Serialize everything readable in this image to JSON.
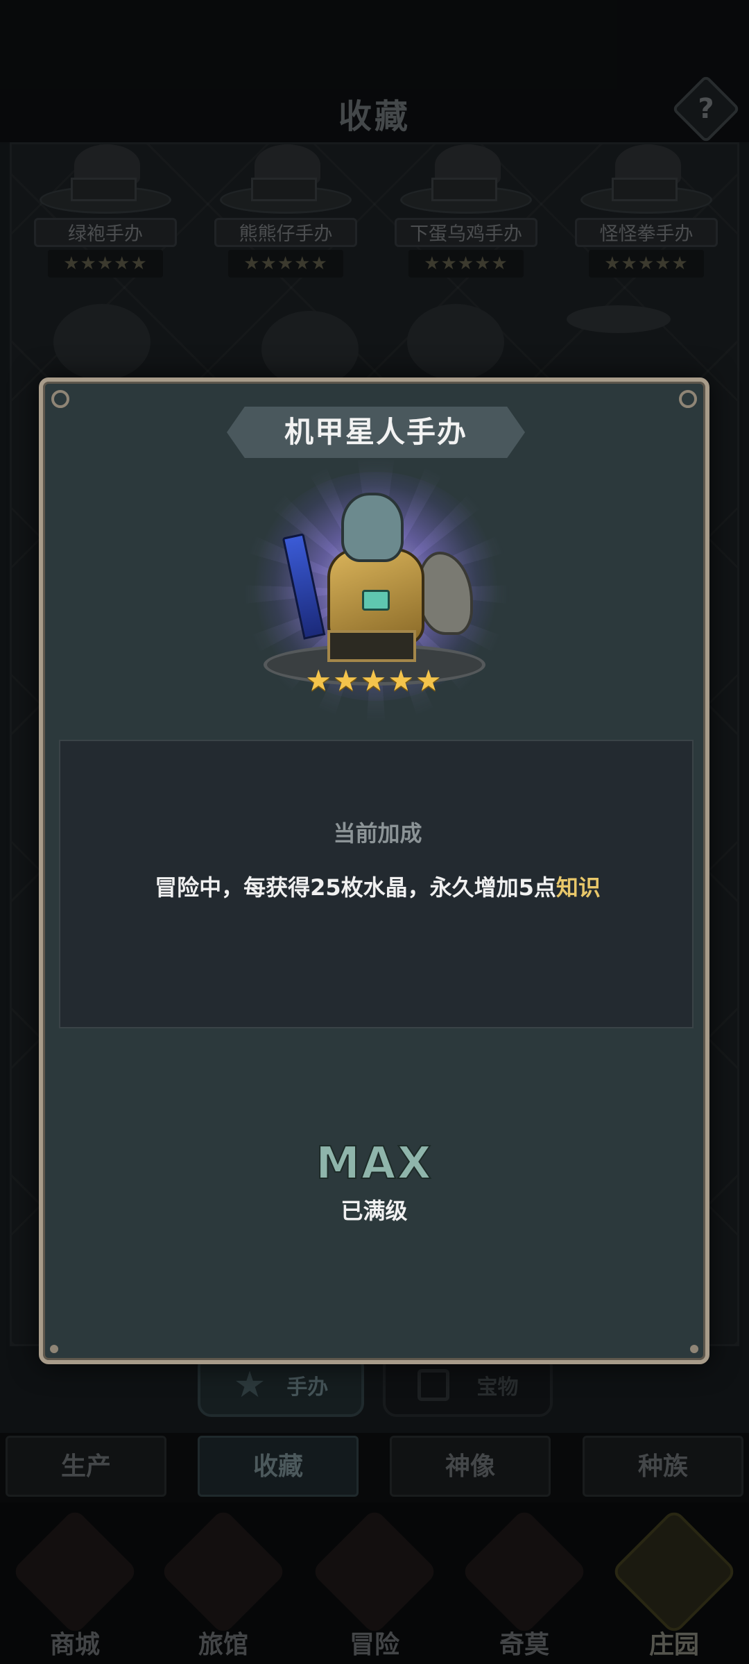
{
  "page": {
    "title": "收藏",
    "help_label": "?"
  },
  "background_figures": [
    {
      "name": "绿袍手办",
      "stars": "★★★★★"
    },
    {
      "name": "熊熊仔手办",
      "stars": "★★★★★"
    },
    {
      "name": "下蛋乌鸡手办",
      "stars": "★★★★★"
    },
    {
      "name": "怪怪拳手办",
      "stars": "★★★★★"
    }
  ],
  "sub_tabs": [
    {
      "label": "手办",
      "icon": "star-icon",
      "active": true
    },
    {
      "label": "宝物",
      "icon": "box-icon",
      "active": false
    }
  ],
  "section_tabs": [
    {
      "label": "生产",
      "active": false
    },
    {
      "label": "收藏",
      "active": true
    },
    {
      "label": "神像",
      "active": false
    },
    {
      "label": "种族",
      "active": false
    }
  ],
  "bottom_nav": [
    {
      "label": "商城",
      "icon": "shop-icon",
      "active": false
    },
    {
      "label": "旅馆",
      "icon": "inn-icon",
      "active": false
    },
    {
      "label": "冒险",
      "icon": "crossed-swords-icon",
      "active": false
    },
    {
      "label": "奇莫",
      "icon": "pet-icon",
      "active": false
    },
    {
      "label": "庄园",
      "icon": "manor-icon",
      "active": true
    }
  ],
  "modal": {
    "title": "机甲星人手办",
    "rating": {
      "stars": "★★★★★",
      "value": 5,
      "max": 5
    },
    "bonus": {
      "title": "当前加成",
      "description_prefix": "冒险中，每获得25枚水晶，永久增加5点",
      "description_highlight": "知识",
      "highlight_color": "#e8c76a"
    },
    "level": {
      "max_label": "MAX",
      "status": "已满级"
    }
  }
}
